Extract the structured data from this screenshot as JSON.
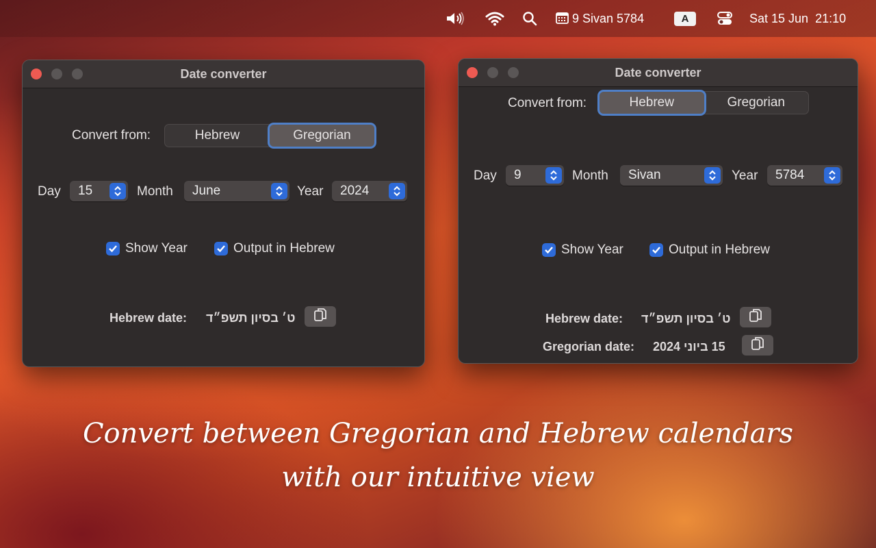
{
  "menubar": {
    "hebrew_date": "9 Sivan 5784",
    "input_source": "A",
    "datetime": "Sat 15 Jun  21:10",
    "icons": [
      "speaker-icon",
      "wifi-icon",
      "search-icon",
      "calendar-icon",
      "input-source-icon",
      "control-center-icon"
    ]
  },
  "left_window": {
    "title": "Date converter",
    "convert_from_label": "Convert from:",
    "options": [
      "Hebrew",
      "Gregorian"
    ],
    "selected": "Gregorian",
    "day_label": "Day",
    "day_value": "15",
    "month_label": "Month",
    "month_value": "June",
    "year_label": "Year",
    "year_value": "2024",
    "show_year_label": "Show Year",
    "show_year_checked": true,
    "output_hebrew_label": "Output in Hebrew",
    "output_hebrew_checked": true,
    "hebrew_date_label": "Hebrew date:",
    "hebrew_date_value": "ט׳ בסיון תשפ״ד"
  },
  "right_window": {
    "title": "Date converter",
    "convert_from_label": "Convert from:",
    "options": [
      "Hebrew",
      "Gregorian"
    ],
    "selected": "Hebrew",
    "day_label": "Day",
    "day_value": "9",
    "month_label": "Month",
    "month_value": "Sivan",
    "year_label": "Year",
    "year_value": "5784",
    "show_year_label": "Show Year",
    "show_year_checked": true,
    "output_hebrew_label": "Output in Hebrew",
    "output_hebrew_checked": true,
    "hebrew_date_label": "Hebrew date:",
    "hebrew_date_value": "ט׳ בסיון תשפ״ד",
    "gregorian_date_label": "Gregorian date:",
    "gregorian_date_value": "15 ביוני 2024"
  },
  "caption": {
    "line1": "Convert between Gregorian and Hebrew calendars",
    "line2": "with our intuitive view"
  },
  "colors": {
    "accent": "#2e6bd9",
    "close_button": "#ee5a52",
    "window_bg": "#2f2b2b"
  }
}
